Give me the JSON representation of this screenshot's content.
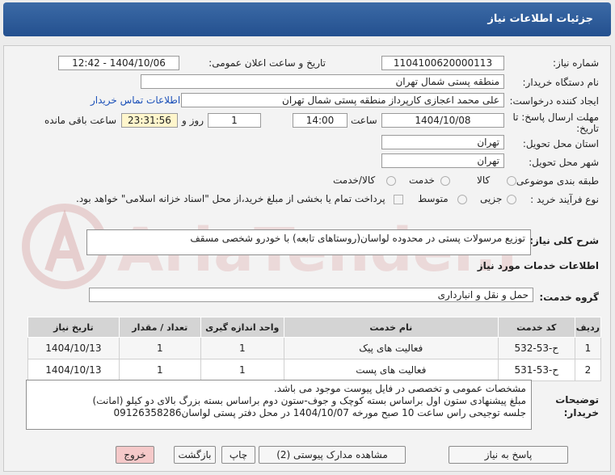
{
  "page_title": "جزئیات اطلاعات نیاز",
  "need_number": {
    "label": "شماره نیاز:",
    "value": "1104100620000113"
  },
  "announce_datetime": {
    "label": "تاریخ و ساعت اعلان عمومی:",
    "value": "1404/10/06 - 12:42"
  },
  "buyer_org": {
    "label": "نام دستگاه خریدار:",
    "value": "منطقه پستی شمال تهران"
  },
  "requester": {
    "label": "ایجاد کننده درخواست:",
    "value": "علی محمد اعجازی کارپرداز منطقه پستی شمال تهران",
    "contact_link": "اطلاعات تماس خریدار"
  },
  "deadline": {
    "label_line1": "مهلت ارسال پاسخ: تا",
    "label_line2": "تاریخ:",
    "date": "1404/10/08",
    "time_label": "ساعت",
    "time": "14:00",
    "days": "1",
    "days_label": "روز و",
    "remaining": "23:31:56",
    "remaining_label": "ساعت باقی مانده"
  },
  "delivery_province": {
    "label": "استان محل تحویل:",
    "value": "تهران"
  },
  "delivery_city": {
    "label": "شهر محل تحویل:",
    "value": "تهران"
  },
  "category": {
    "label": "طبقه بندی موضوعی:",
    "options": [
      "کالا",
      "خدمت",
      "کالا/خدمت"
    ],
    "selected": "خدمت"
  },
  "purchase_type": {
    "label": "نوع فرآیند خرید :",
    "options": [
      "جزیی",
      "متوسط"
    ],
    "selected": "جزیی",
    "payment_note": "پرداخت تمام یا بخشی از مبلغ خرید،از محل \"اسناد خزانه اسلامی\" خواهد بود."
  },
  "description": {
    "label": "شرح کلی نیاز:",
    "value": "توزیع مرسولات پستی در محدوده لواسان(روستاهای تابعه) با خودرو شخصی مسقف"
  },
  "services_section_title": "اطلاعات خدمات مورد نیاز",
  "service_group": {
    "label": "گروه خدمت:",
    "value": "حمل و نقل و انبارداری"
  },
  "table": {
    "headers": [
      "ردیف",
      "کد خدمت",
      "نام خدمت",
      "واحد اندازه گیری",
      "تعداد / مقدار",
      "تاریخ نیاز"
    ],
    "rows": [
      [
        "1",
        "ح-53-532",
        "فعالیت های پیک",
        "1",
        "1",
        "1404/10/13"
      ],
      [
        "2",
        "ح-53-531",
        "فعالیت های پست",
        "1",
        "1",
        "1404/10/13"
      ]
    ]
  },
  "buyer_notes": {
    "label_line1": "توضیحات",
    "label_line2": "خریدار:",
    "lines": [
      "مشخصات  عمومی و تخصصی در فایل پیوست موجود می باشد.",
      "مبلغ پیشنهادی ستون اول براساس بسته کوچک و جوف-ستون دوم براساس بسته  بزرگ بالای دو کیلو (امانت)",
      "جلسه توجیحی راس ساعت 10 صبح مورخه 1404/10/07 در محل دفتر پستی لواسان09126358286"
    ]
  },
  "watermark": "AriaTender.net",
  "buttons": {
    "reply": "پاسخ به نیاز",
    "view_docs": "مشاهده مدارک پیوستی (2)",
    "print": "چاپ",
    "back": "بازگشت",
    "exit": "خروج"
  },
  "colors": {
    "titlebar": "#2f5c99",
    "link": "#1a4fb8",
    "exit_button": "#f5c9c9",
    "watermark": "#d9a3a3"
  }
}
